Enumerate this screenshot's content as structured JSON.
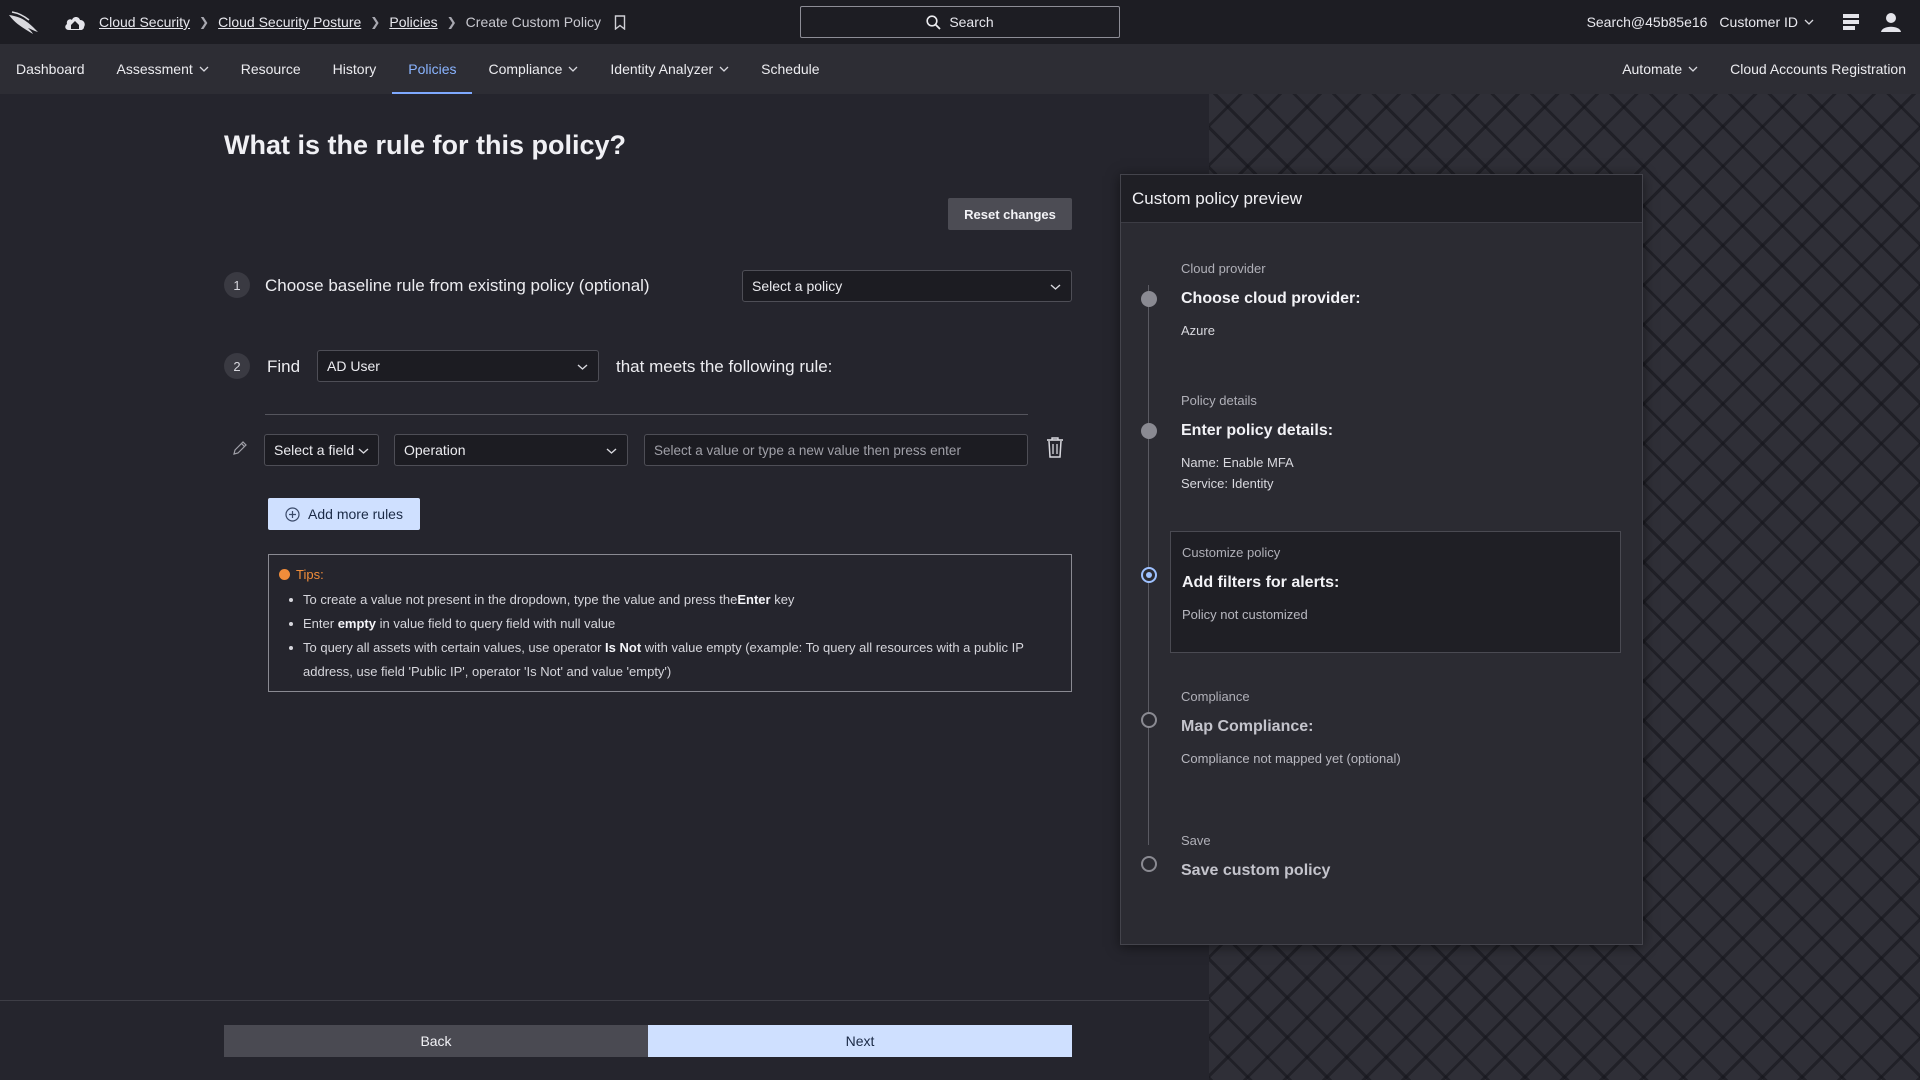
{
  "breadcrumb": {
    "items": [
      "Cloud Security",
      "Cloud Security Posture",
      "Policies"
    ],
    "current": "Create Custom Policy"
  },
  "search": {
    "label": "Search"
  },
  "top_right": {
    "user": "Search@45b85e16",
    "customer": "Customer ID"
  },
  "nav": {
    "left": [
      {
        "label": "Dashboard"
      },
      {
        "label": "Assessment"
      },
      {
        "label": "Resource"
      },
      {
        "label": "History"
      },
      {
        "label": "Policies"
      },
      {
        "label": "Compliance"
      },
      {
        "label": "Identity Analyzer"
      },
      {
        "label": "Schedule"
      }
    ],
    "right": [
      {
        "label": "Automate"
      },
      {
        "label": "Cloud Accounts Registration"
      }
    ]
  },
  "main": {
    "title": "What is the rule for this policy?",
    "reset_label": "Reset changes",
    "step1": {
      "num": "1",
      "label": "Choose baseline rule from existing policy (optional)",
      "select": "Select a policy"
    },
    "step2": {
      "num": "2",
      "find": "Find",
      "resource": "AD User",
      "suffix": "that meets the following rule:"
    },
    "rule": {
      "field": "Select a field",
      "operation": "Operation",
      "value_placeholder": "Select a value or type a new value then press enter"
    },
    "add_rules_label": "Add more rules",
    "tips": {
      "title": "Tips:",
      "t1_a": "To create a value not present in the dropdown, type the value and press the",
      "t1_b": "Enter",
      "t1_c": " key",
      "t2_a": "Enter ",
      "t2_b": "empty",
      "t2_c": " in value field to query field with null value",
      "t3_a": "To query all assets with certain values, use operator ",
      "t3_b": "Is Not",
      "t3_c": " with value empty (example: To query all resources with a public IP address, use field 'Public IP', operator 'Is Not' and value 'empty')"
    }
  },
  "footer": {
    "back": "Back",
    "next": "Next"
  },
  "preview": {
    "title": "Custom policy preview",
    "steps": [
      {
        "category": "Cloud provider",
        "heading": "Choose cloud provider:",
        "value": "Azure"
      },
      {
        "category": "Policy details",
        "heading": "Enter policy details:",
        "value1": "Name: Enable MFA",
        "value2": "Service: Identity"
      },
      {
        "category": "Customize policy",
        "heading": "Add filters for alerts:",
        "value": "Policy not customized"
      },
      {
        "category": "Compliance",
        "heading": "Map Compliance:",
        "value": "Compliance not mapped yet (optional)"
      },
      {
        "category": "Save",
        "heading": "Save custom policy"
      }
    ]
  },
  "colors": {
    "accent": "#7ea9ff",
    "primary_button": "#cfe0ff",
    "tips": "#f08c3a"
  }
}
